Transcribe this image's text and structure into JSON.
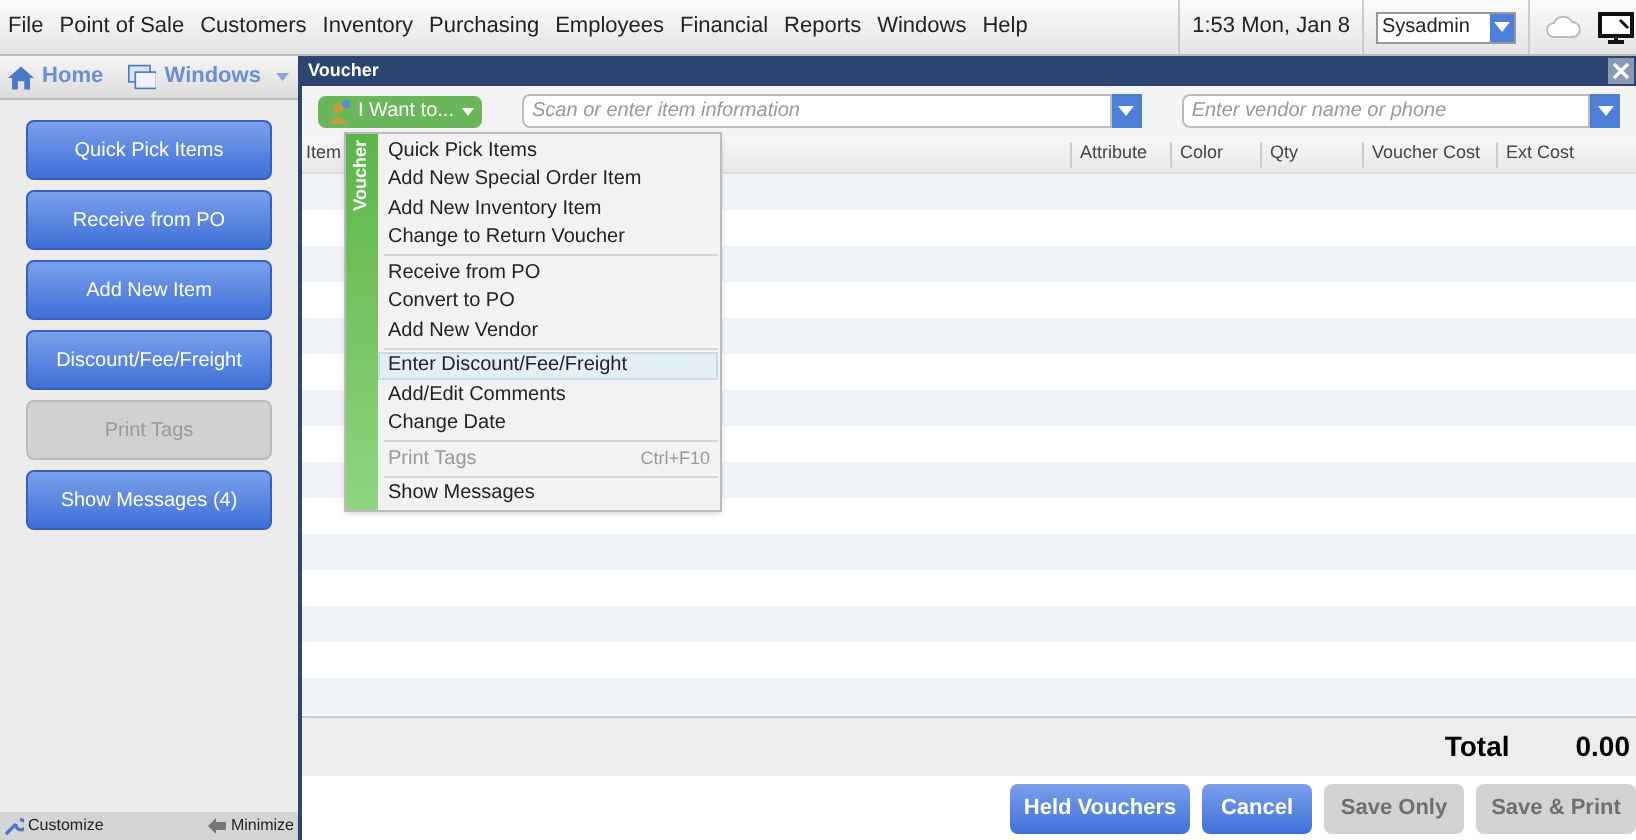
{
  "menu_bar": {
    "items": [
      "File",
      "Point of Sale",
      "Customers",
      "Inventory",
      "Purchasing",
      "Employees",
      "Financial",
      "Reports",
      "Windows",
      "Help"
    ],
    "clock": "1:53 Mon, Jan 8",
    "user": "Sysadmin"
  },
  "sidebar": {
    "home": "Home",
    "windows": "Windows",
    "buttons": [
      {
        "label": "Quick Pick Items",
        "disabled": false
      },
      {
        "label": "Receive from PO",
        "disabled": false
      },
      {
        "label": "Add New Item",
        "disabled": false
      },
      {
        "label": "Discount/Fee/Freight",
        "disabled": false
      },
      {
        "label": "Print Tags",
        "disabled": true
      },
      {
        "label": "Show Messages (4)",
        "disabled": false
      }
    ],
    "customize": "Customize",
    "minimize": "Minimize"
  },
  "window": {
    "title": "Voucher"
  },
  "toolbar": {
    "i_want_to": "I Want to...",
    "item_search": {
      "placeholder": "Scan or enter item information"
    },
    "vendor_search": {
      "placeholder": "Enter vendor name or phone"
    }
  },
  "table": {
    "columns": [
      "Item",
      "Attribute",
      "Color",
      "Qty",
      "Voucher Cost",
      "Ext Cost"
    ]
  },
  "popup_menu": {
    "side_label": "Voucher",
    "groups": [
      [
        {
          "label": "Quick Pick Items",
          "selected": false,
          "disabled": false
        },
        {
          "label": "Add New Special Order Item",
          "selected": false,
          "disabled": false
        },
        {
          "label": "Add New Inventory Item",
          "selected": false,
          "disabled": false
        },
        {
          "label": "Change to Return Voucher",
          "selected": false,
          "disabled": false
        }
      ],
      [
        {
          "label": "Receive from PO",
          "selected": false,
          "disabled": false
        },
        {
          "label": "Convert to PO",
          "selected": false,
          "disabled": false
        },
        {
          "label": "Add New Vendor",
          "selected": false,
          "disabled": false
        }
      ],
      [
        {
          "label": "Enter Discount/Fee/Freight",
          "selected": true,
          "disabled": false
        },
        {
          "label": "Add/Edit Comments",
          "selected": false,
          "disabled": false
        },
        {
          "label": "Change Date",
          "selected": false,
          "disabled": false
        }
      ],
      [
        {
          "label": "Print Tags",
          "selected": false,
          "disabled": true,
          "shortcut": "Ctrl+F10"
        }
      ],
      [
        {
          "label": "Show Messages",
          "selected": false,
          "disabled": false
        }
      ]
    ]
  },
  "total": {
    "label": "Total",
    "value": "0.00"
  },
  "buttons": [
    {
      "label": "Held Vouchers",
      "disabled": false
    },
    {
      "label": "Cancel",
      "disabled": false
    },
    {
      "label": "Save Only",
      "disabled": true
    },
    {
      "label": "Save & Print",
      "disabled": true
    }
  ]
}
